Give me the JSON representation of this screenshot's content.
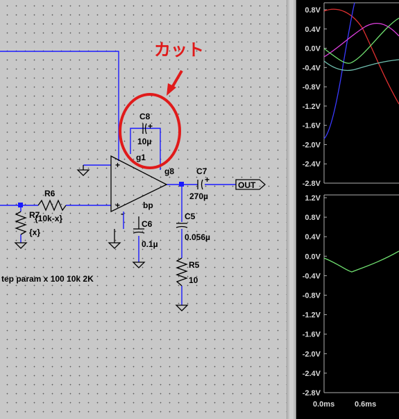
{
  "schematic": {
    "components": {
      "c8": {
        "ref": "C8",
        "value": "10µ"
      },
      "c7": {
        "ref": "C7",
        "value": "270µ"
      },
      "c6": {
        "ref": "C6",
        "value": "0.1µ"
      },
      "c5": {
        "ref": "C5",
        "value": "0.056µ"
      },
      "r6": {
        "ref": "R6",
        "value": "{10k-x}"
      },
      "r7": {
        "ref": "R7",
        "value": "{x}"
      },
      "r5": {
        "ref": "R5",
        "value": "10"
      }
    },
    "opamp": {
      "pin_g1": "g1",
      "pin_g8": "g8",
      "pin_bp": "bp",
      "plus": "+",
      "minus": "-"
    },
    "c8_pol": "+",
    "c7_pol": "+",
    "out_label": "OUT",
    "directive": "tep param x 100 10k 2K",
    "annotation": {
      "text": "カット",
      "color": "#e01a1a"
    }
  },
  "waveform": {
    "top_pane": {
      "y_ticks": [
        "0.8V",
        "0.4V",
        "0.0V",
        "-0.4V",
        "-0.8V",
        "-1.2V",
        "-1.6V",
        "-2.0V",
        "-2.4V",
        "-2.8V"
      ]
    },
    "bottom_pane": {
      "y_ticks": [
        "1.2V",
        "0.8V",
        "0.4V",
        "0.0V",
        "-0.4V",
        "-0.8V",
        "-1.2V",
        "-1.6V",
        "-2.0V",
        "-2.4V",
        "-2.8V"
      ]
    },
    "x_ticks": [
      "0.0ms",
      "0.6ms"
    ],
    "trace_colors": {
      "red": "#e03030",
      "blue": "#3a3aff",
      "magenta": "#e040e0",
      "green": "#70e070",
      "teal": "#70c0b0"
    }
  }
}
